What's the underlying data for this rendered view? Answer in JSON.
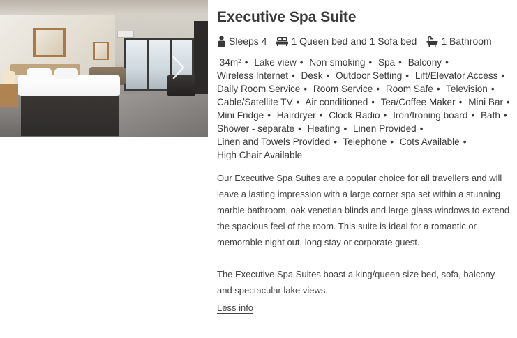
{
  "room": {
    "title": "Executive Spa Suite",
    "summary": {
      "sleeps": "Sleeps 4",
      "beds": "1 Queen bed and 1 Sofa bed",
      "bathrooms": "1 Bathroom"
    },
    "features": [
      "34m²",
      "Lake view",
      "Non-smoking",
      "Spa",
      "Balcony",
      "Wireless Internet",
      "Desk",
      "Outdoor Setting",
      "Lift/Elevator Access",
      "Daily Room Service",
      "Room Service",
      "Room Safe",
      "Television",
      "Cable/Satellite TV",
      "Air conditioned",
      "Tea/Coffee Maker",
      "Mini Bar",
      "Mini Fridge",
      "Hairdryer",
      "Clock Radio",
      "Iron/Ironing board",
      "Bath",
      "Shower - separate",
      "Heating",
      "Linen Provided",
      "Linen and Towels Provided",
      "Telephone",
      "Cots Available",
      "High Chair Available"
    ],
    "description": [
      "Our Executive Spa Suites are a popular choice for all travellers and will leave a lasting impression with a large corner spa set within a stunning marble bathroom, oak venetian blinds and large glass windows to extend the spacious feel of the room. This suite is ideal for a romantic or memorable night out, long stay or corporate guest.",
      "The Executive Spa Suites boast a king/queen size bed, sofa, balcony and spectacular lake views."
    ],
    "less_info": "Less info"
  },
  "icons": {
    "sleeps": "person-icon",
    "beds": "bed-icon",
    "bathrooms": "bathtub-icon",
    "next": "chevron-right-icon"
  },
  "colors": {
    "text": "#3a3a3a",
    "body_text": "#444444"
  }
}
